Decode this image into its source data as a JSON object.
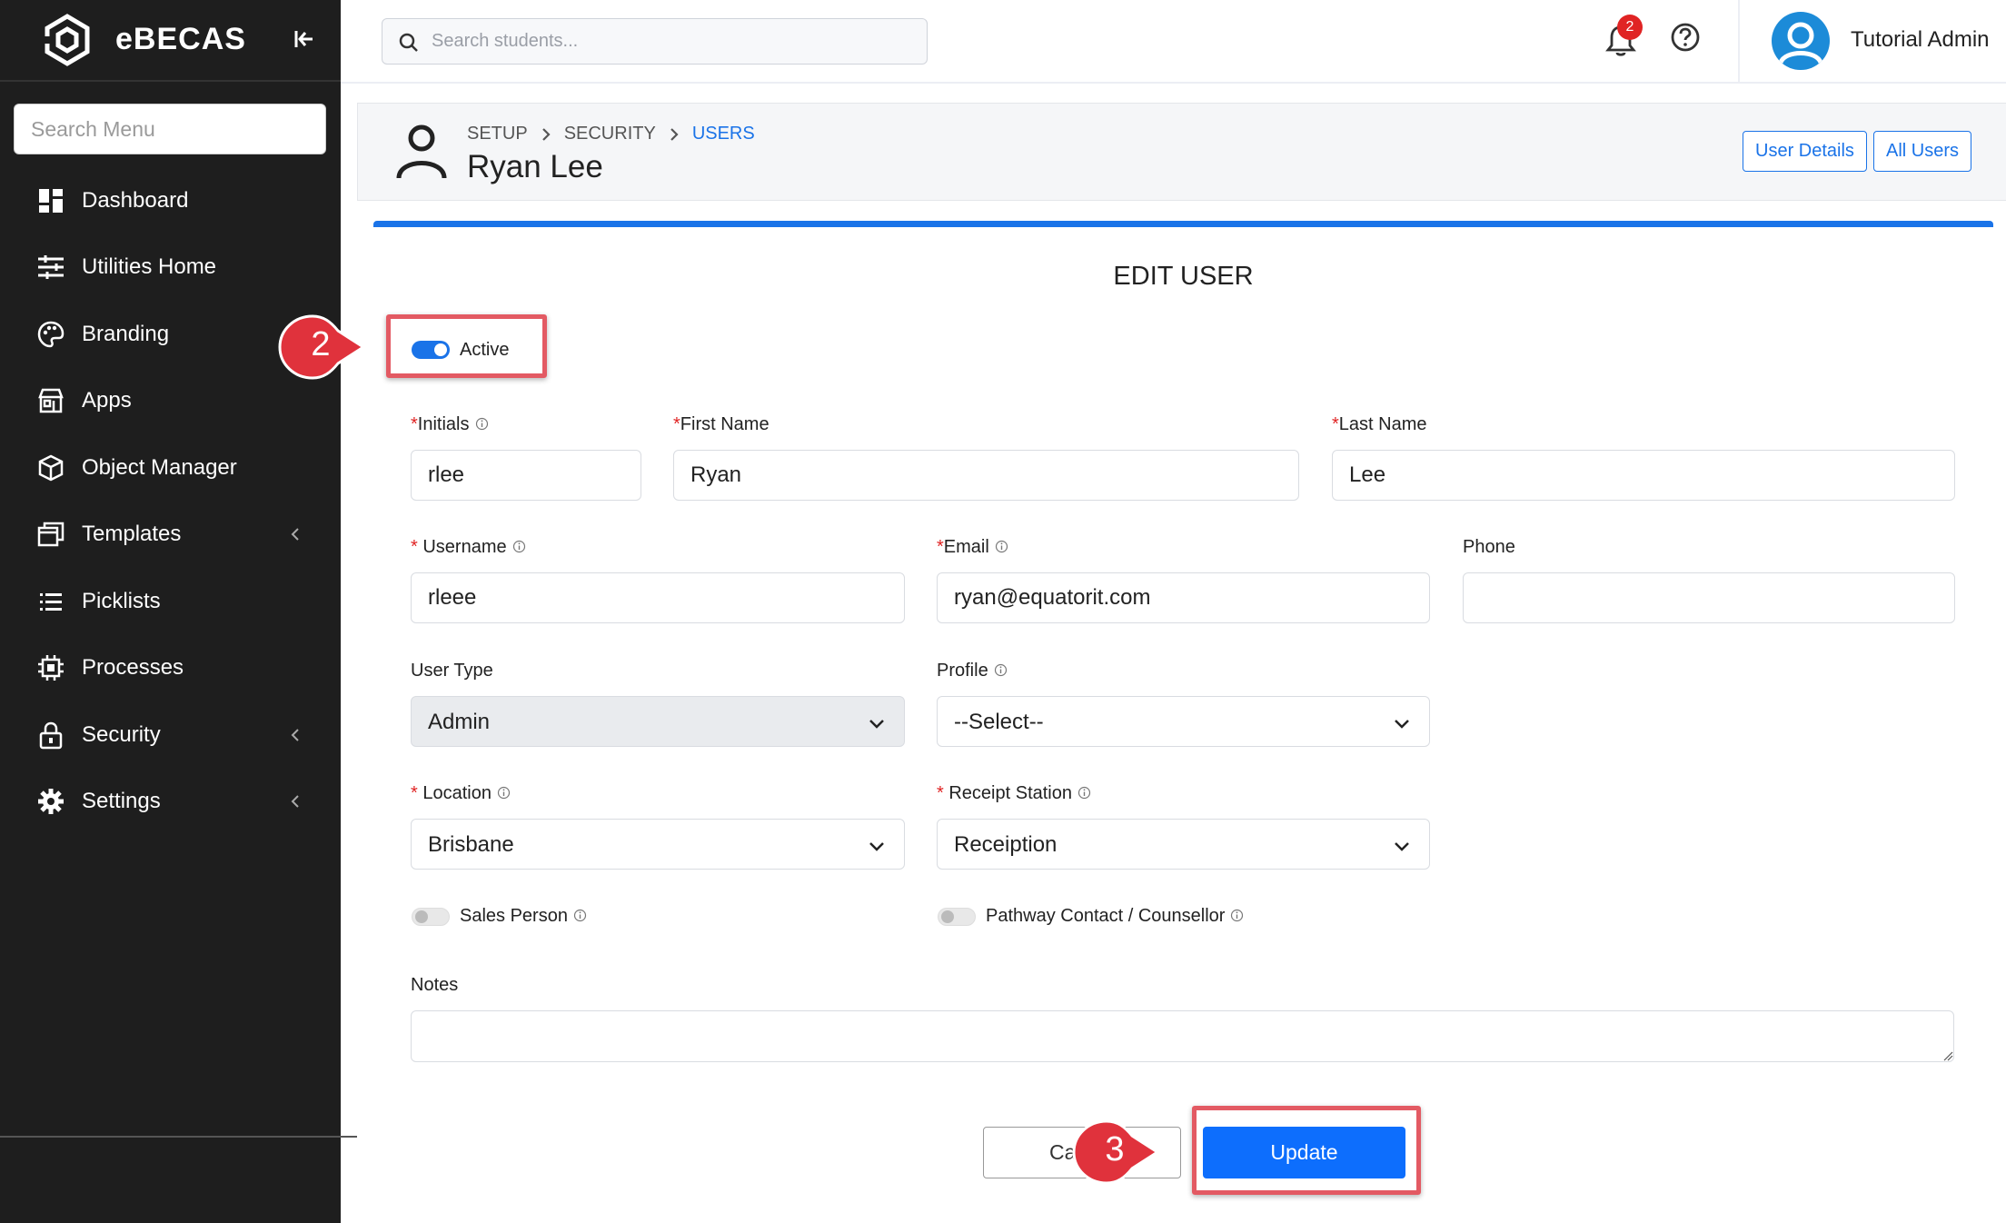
{
  "sidebar": {
    "brand": "eBECAS",
    "search_placeholder": "Search Menu",
    "items": [
      {
        "label": "Dashboard",
        "icon": "dashboard-icon",
        "has_submenu": false
      },
      {
        "label": "Utilities Home",
        "icon": "sliders-icon",
        "has_submenu": false
      },
      {
        "label": "Branding",
        "icon": "palette-icon",
        "has_submenu": false
      },
      {
        "label": "Apps",
        "icon": "store-icon",
        "has_submenu": false
      },
      {
        "label": "Object Manager",
        "icon": "cube-icon",
        "has_submenu": false
      },
      {
        "label": "Templates",
        "icon": "windows-icon",
        "has_submenu": true
      },
      {
        "label": "Picklists",
        "icon": "list-icon",
        "has_submenu": false
      },
      {
        "label": "Processes",
        "icon": "chip-icon",
        "has_submenu": false
      },
      {
        "label": "Security",
        "icon": "lock-icon",
        "has_submenu": true
      },
      {
        "label": "Settings",
        "icon": "gear-icon",
        "has_submenu": true
      }
    ]
  },
  "topbar": {
    "search_placeholder": "Search students...",
    "notification_count": "2",
    "user_name": "Tutorial Admin"
  },
  "header": {
    "breadcrumb": [
      "SETUP",
      "SECURITY",
      "USERS"
    ],
    "title": "Ryan Lee",
    "buttons": {
      "user_details": "User Details",
      "all_users": "All Users"
    }
  },
  "form": {
    "title": "EDIT USER",
    "active_label": "Active",
    "active": true,
    "fields": {
      "initials": {
        "label": "Initials",
        "value": "rlee"
      },
      "first_name": {
        "label": "First Name",
        "value": "Ryan"
      },
      "last_name": {
        "label": "Last Name",
        "value": "Lee"
      },
      "username": {
        "label": "Username",
        "value": "rleee"
      },
      "email": {
        "label": "Email",
        "value": "ryan@equatorit.com"
      },
      "phone": {
        "label": "Phone",
        "value": ""
      },
      "user_type": {
        "label": "User Type",
        "value": "Admin"
      },
      "profile": {
        "label": "Profile",
        "value": "--Select--"
      },
      "location": {
        "label": "Location",
        "value": "Brisbane"
      },
      "receipt_station": {
        "label": "Receipt Station",
        "value": "Receiption"
      },
      "notes": {
        "label": "Notes",
        "value": ""
      }
    },
    "sales_person_label": "Sales Person",
    "sales_person": false,
    "pathway_label": "Pathway Contact / Counsellor",
    "pathway": false,
    "required_mark": "*",
    "cancel_label": "Cancel",
    "update_label": "Update"
  },
  "annotations": {
    "step_active": "2",
    "step_update": "3",
    "highlight_color": "#e35a63"
  },
  "colors": {
    "accent": "#1a73e8",
    "sidebar_bg": "#1e1e1e",
    "update_button": "#0d6efd",
    "badge": "#e02424"
  }
}
